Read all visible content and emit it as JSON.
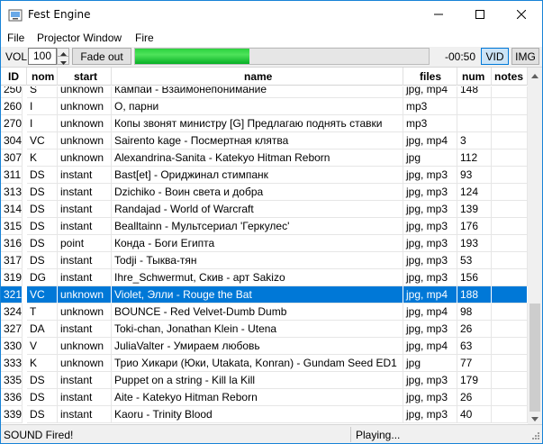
{
  "window": {
    "title": "Fest Engine"
  },
  "menu": {
    "items": [
      "File",
      "Projector Window",
      "Fire"
    ]
  },
  "toolbar": {
    "vol_label": "VOL",
    "volume": "100",
    "fade_label": "Fade out",
    "progress_fraction": 0.39,
    "progress_color": "#06b025",
    "time": "-00:50",
    "vid_label": "VID",
    "img_label": "IMG"
  },
  "table": {
    "columns": [
      "ID",
      "nom",
      "start",
      "name",
      "files",
      "num",
      "notes"
    ],
    "rows": [
      {
        "id": "250",
        "nom": "S",
        "start": "unknown",
        "name": "Кампай - Взаимонепонимание",
        "files": "jpg, mp4",
        "num": "148",
        "notes": "",
        "selected": false
      },
      {
        "id": "260",
        "nom": "I",
        "start": "unknown",
        "name": "О, парни",
        "files": "mp3",
        "num": "",
        "notes": "",
        "selected": false
      },
      {
        "id": "270",
        "nom": "I",
        "start": "unknown",
        "name": "Копы звонят министру [G] Предлагаю поднять ставки",
        "files": "mp3",
        "num": "",
        "notes": "",
        "selected": false
      },
      {
        "id": "304",
        "nom": "VC",
        "start": "unknown",
        "name": "Sairento kage - Посмертная клятва",
        "files": "jpg, mp4",
        "num": "3",
        "notes": "",
        "selected": false
      },
      {
        "id": "307",
        "nom": "K",
        "start": "unknown",
        "name": "Alexandrina-Sanita - Katekyo Hitman Reborn",
        "files": "jpg",
        "num": "112",
        "notes": "",
        "selected": false
      },
      {
        "id": "311",
        "nom": "DS",
        "start": "instant",
        "name": "Bast[et] - Ориджинал стимпанк",
        "files": "jpg, mp3",
        "num": "93",
        "notes": "",
        "selected": false
      },
      {
        "id": "313",
        "nom": "DS",
        "start": "instant",
        "name": "Dzichiko - Воин света и добра",
        "files": "jpg, mp3",
        "num": "124",
        "notes": "",
        "selected": false
      },
      {
        "id": "314",
        "nom": "DS",
        "start": "instant",
        "name": "Randajad - World of Warcraft",
        "files": "jpg, mp3",
        "num": "139",
        "notes": "",
        "selected": false
      },
      {
        "id": "315",
        "nom": "DS",
        "start": "instant",
        "name": "Bealltainn - Мультсериал 'Геркулес'",
        "files": "jpg, mp3",
        "num": "176",
        "notes": "",
        "selected": false
      },
      {
        "id": "316",
        "nom": "DS",
        "start": "point",
        "name": "Конда - Боги Египта",
        "files": "jpg, mp3",
        "num": "193",
        "notes": "",
        "selected": false
      },
      {
        "id": "317",
        "nom": "DS",
        "start": "instant",
        "name": "Todji - Тыква-тян",
        "files": "jpg, mp3",
        "num": "53",
        "notes": "",
        "selected": false
      },
      {
        "id": "319",
        "nom": "DG",
        "start": "instant",
        "name": "Ihre_Schwermut, Скив - арт Sakizo",
        "files": "jpg, mp3",
        "num": "156",
        "notes": "",
        "selected": false
      },
      {
        "id": "321",
        "nom": "VC",
        "start": "unknown",
        "name": "Violet, Элли - Rouge the Bat",
        "files": "jpg, mp4",
        "num": "188",
        "notes": "",
        "selected": true
      },
      {
        "id": "324",
        "nom": "T",
        "start": "unknown",
        "name": "BOUNCE - Red Velvet-Dumb Dumb",
        "files": "jpg, mp4",
        "num": "98",
        "notes": "",
        "selected": false
      },
      {
        "id": "327",
        "nom": "DA",
        "start": "instant",
        "name": "Toki-chan, Jonathan Klein - Utena",
        "files": "jpg, mp3",
        "num": "26",
        "notes": "",
        "selected": false
      },
      {
        "id": "330",
        "nom": "V",
        "start": "unknown",
        "name": "JuliaValter - Умираем любовь",
        "files": "jpg, mp4",
        "num": "63",
        "notes": "",
        "selected": false
      },
      {
        "id": "333",
        "nom": "K",
        "start": "unknown",
        "name": "Трио Хикари (Юки, Utakata, Konran) - Gundam Seed ED1",
        "files": "jpg",
        "num": "77",
        "notes": "",
        "selected": false
      },
      {
        "id": "335",
        "nom": "DS",
        "start": "instant",
        "name": "Puppet on a string - Kill la Kill",
        "files": "jpg, mp3",
        "num": "179",
        "notes": "",
        "selected": false
      },
      {
        "id": "336",
        "nom": "DS",
        "start": "instant",
        "name": "Aite - Katekyo Hitman Reborn",
        "files": "jpg, mp3",
        "num": "26",
        "notes": "",
        "selected": false
      },
      {
        "id": "339",
        "nom": "DS",
        "start": "instant",
        "name": "Kaoru - Trinity Blood",
        "files": "jpg, mp3",
        "num": "40",
        "notes": "",
        "selected": false
      }
    ]
  },
  "status": {
    "left": "SOUND Fired!",
    "right": "Playing..."
  },
  "colors": {
    "selection": "#0078d7",
    "window_border": "#1883d7"
  },
  "icons": {
    "app": "app-icon",
    "minimize": "minimize-icon",
    "maximize": "maximize-icon",
    "close": "close-icon"
  }
}
